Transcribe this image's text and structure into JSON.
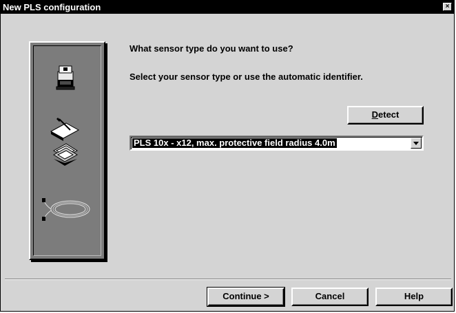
{
  "window": {
    "title": "New PLS configuration",
    "close_glyph": "×"
  },
  "side_panel": {
    "icons": [
      "sensor-device-icon",
      "floppy-disks-icon",
      "cable-icon"
    ]
  },
  "main": {
    "question": "What sensor type do you want to use?",
    "instruction": "Select your sensor type or use the automatic identifier."
  },
  "detect_button": {
    "mnemonic": "D",
    "rest": "etect"
  },
  "sensor_select": {
    "value": "PLS 10x - x12, max. protective field radius 4.0m"
  },
  "footer": {
    "continue_label": "Continue >",
    "cancel_label": "Cancel",
    "help_label": "Help"
  }
}
